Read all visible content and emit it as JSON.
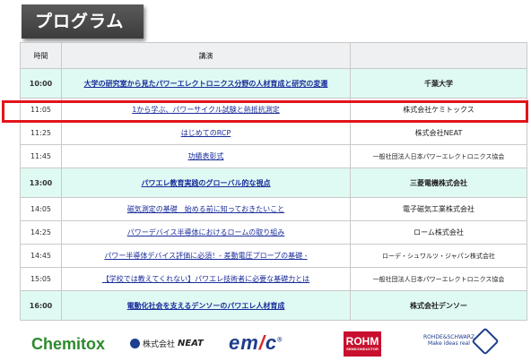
{
  "title": "プログラム",
  "table": {
    "headers": [
      "時間",
      "講演",
      ""
    ],
    "rows": [
      {
        "time": "10:00",
        "talk": "大学の研究室から見たパワーエレクトロニクス分野の人材育成と研究の変遷",
        "org": "千葉大学",
        "highlight": true
      },
      {
        "time": "11:05",
        "talk": "1から学ぶ、パワーサイクル試験と熱抵抗測定",
        "org": "株式会社ケミトックス",
        "highlight": false
      },
      {
        "time": "11:25",
        "talk": "はじめてのRCP",
        "org": "株式会社NEAT",
        "highlight": false
      },
      {
        "time": "11:45",
        "talk": "功績表彰式",
        "org": "一般社団法人日本パワーエレクトロニクス協会",
        "highlight": false
      },
      {
        "time": "13:00",
        "talk": "パワエレ教育実践のグローバル的な視点",
        "org": "三菱電機株式会社",
        "highlight": true
      },
      {
        "time": "14:05",
        "talk": "磁気測定の基礎　始める前に知っておきたいこと",
        "org": "電子磁気工業株式会社",
        "highlight": false
      },
      {
        "time": "14:25",
        "talk": "パワーデバイス半導体におけるロームの取り組み",
        "org": "ローム株式会社",
        "highlight": false
      },
      {
        "time": "14:45",
        "talk": "パワー半導体デバイス評価に必須！- 差動電圧プローブの基礎 -",
        "org": "ローデ・シュワルツ・ジャパン株式会社",
        "highlight": false
      },
      {
        "time": "15:05",
        "talk": "【学校では教えてくれない】パワエレ技術者に必要な基礎力とは",
        "org": "一般社団法人日本パワーエレクトロニクス協会",
        "highlight": false
      },
      {
        "time": "16:00",
        "talk": "電動化社会を支えるデンソーのパワエレ人材育成",
        "org": "株式会社デンソー",
        "highlight": true
      }
    ]
  },
  "logos": {
    "chemitox": "Chemitox",
    "neat_prefix": "株式会社",
    "neat": "NEAT",
    "emc_left": "em",
    "emc_slash": "/",
    "emc_right": "c",
    "emc_reg": "®",
    "rohm": "ROHM",
    "rohm_sub": "SEMICONDUCTOR",
    "rs": "ROHDE&SCHWARZ",
    "rs_sub": "Make ideas real"
  },
  "colors": {
    "highlight_row": "#dffaf3",
    "link": "#1a2c9a",
    "red_box": "#e2141b"
  }
}
